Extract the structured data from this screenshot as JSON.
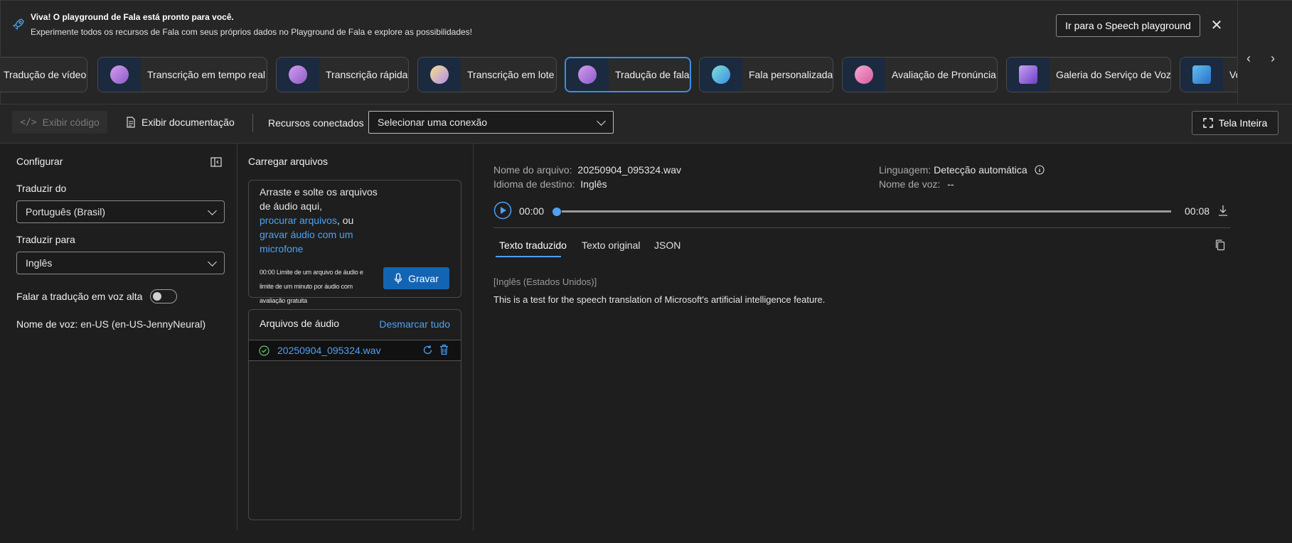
{
  "banner": {
    "title": "Viva! O playground de Fala está pronto para você.",
    "subtitle": "Experimente todos os recursos de Fala com seus próprios dados no Playground de Fala e explore as possibilidades!",
    "goto_label": "Ir para o Speech playground",
    "close_glyph": "✕"
  },
  "nav": {
    "prev_glyph": "‹",
    "next_glyph": "›"
  },
  "tiles": [
    {
      "label": "Tradução de vídeo",
      "active": false
    },
    {
      "label": "Transcrição em tempo real",
      "active": false
    },
    {
      "label": "Transcrição rápida",
      "active": false
    },
    {
      "label": "Transcrição em lote",
      "active": false
    },
    {
      "label": "Tradução de fala",
      "active": true
    },
    {
      "label": "Fala personalizada",
      "active": false
    },
    {
      "label": "Avaliação de Pronúncia",
      "active": false
    },
    {
      "label": "Galeria do Serviço de Voz",
      "active": false
    },
    {
      "label": "Vo",
      "active": false
    }
  ],
  "toolbar": {
    "view_code": "Exibir código",
    "view_docs": "Exibir documentação",
    "connected_resources": "Recursos conectados",
    "connection_placeholder": "Selecionar uma conexão",
    "fullscreen": "Tela Inteira"
  },
  "config": {
    "title": "Configurar",
    "translate_from_label": "Traduzir do",
    "translate_from_value": "Português (Brasil)",
    "translate_to_label": "Traduzir para",
    "translate_to_value": "Inglês",
    "speak_label": "Falar a tradução em voz alta",
    "speak_on": false,
    "voice_name_label": "Nome de voz:",
    "voice_name_value": "en-US (en-US-JennyNeural)"
  },
  "upload": {
    "title": "Carregar arquivos",
    "drop_line1": "Arraste e solte os arquivos",
    "drop_line2": "de áudio aqui,",
    "browse_link": "procurar arquivos",
    "or_text": ", ou",
    "record_link_line1": "gravar áudio com um",
    "record_link_line2": "microfone",
    "limit_line1": "00:00 Limite de um arquivo de áudio e",
    "limit_line2": "limite de um minuto por áudio com",
    "limit_line3": "avaliação gratuita",
    "record_button": "Gravar",
    "files_title": "Arquivos de áudio",
    "unselect_all": "Desmarcar tudo",
    "files": [
      {
        "name": "20250904_095324.wav"
      }
    ]
  },
  "result": {
    "file_name_label": "Nome do arquivo:",
    "file_name_value": "20250904_095324.wav",
    "target_lang_label": "Idioma de destino:",
    "target_lang_value": "Inglês",
    "language_label": "Linguagem:",
    "language_value": "Detecção automática",
    "voice_label": "Nome de voz:",
    "voice_value": "--",
    "time_current": "00:00",
    "time_total": "00:08",
    "progress": 0,
    "tabs": [
      "Texto traduzido",
      "Texto original",
      "JSON"
    ],
    "selected_tab": 0,
    "locale_tag": "[Inglês (Estados Unidos)]",
    "translated_text": "This is a test for the speech translation of Microsoft's artificial intelligence feature."
  },
  "colors": {
    "accent": "#3a8ee6",
    "link": "#4ea1f3",
    "record_button": "#1464b4"
  }
}
